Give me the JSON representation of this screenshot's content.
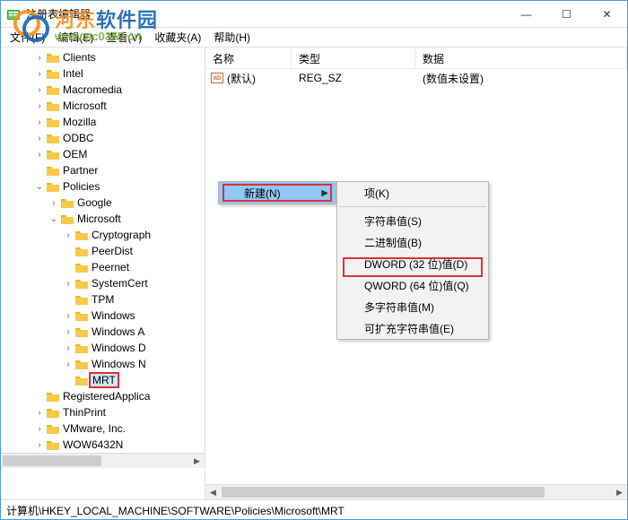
{
  "window": {
    "title": "注册表编辑器"
  },
  "window_controls": {
    "min": "—",
    "max": "☐",
    "close": "✕"
  },
  "menu": {
    "file": "文件(F)",
    "edit": "编辑(E)",
    "view": "查看(V)",
    "fav": "收藏夹(A)",
    "help": "帮助(H)"
  },
  "list": {
    "cols": {
      "name": "名称",
      "type": "类型",
      "data": "数据"
    },
    "row0": {
      "name": "(默认)",
      "type": "REG_SZ",
      "data": "(数值未设置)"
    },
    "ab": "ab"
  },
  "statusbar": "计算机\\HKEY_LOCAL_MACHINE\\SOFTWARE\\Policies\\Microsoft\\MRT",
  "tree": {
    "clients": "Clients",
    "intel": "Intel",
    "macromedia": "Macromedia",
    "microsoft": "Microsoft",
    "mozilla": "Mozilla",
    "odbc": "ODBC",
    "oem": "OEM",
    "partner": "Partner",
    "policies": "Policies",
    "google": "Google",
    "microsoft2": "Microsoft",
    "cryptograph": "Cryptograph",
    "peerdist": "PeerDist",
    "peernet": "Peernet",
    "systemcert": "SystemCert",
    "tpm": "TPM",
    "windows": "Windows",
    "windowsa": "Windows A",
    "windowsd": "Windows D",
    "windowsn": "Windows N",
    "mrt": "MRT",
    "registeredapp": "RegisteredApplica",
    "thinprint": "ThinPrint",
    "vmware": "VMware, Inc.",
    "wow": "WOW6432N"
  },
  "twist": {
    "open": "⌄",
    "closed": "›"
  },
  "ctx1": {
    "new": "新建(N)"
  },
  "ctx2": {
    "key": "项(K)",
    "string": "字符串值(S)",
    "binary": "二进制值(B)",
    "dword": "DWORD (32 位)值(D)",
    "qword": "QWORD (64 位)值(Q)",
    "multi": "多字符串值(M)",
    "expand": "可扩充字符串值(E)"
  },
  "watermark": {
    "line1_a": "河东",
    "line1_b": "软件园",
    "line2": "www.pc0359.cn"
  }
}
